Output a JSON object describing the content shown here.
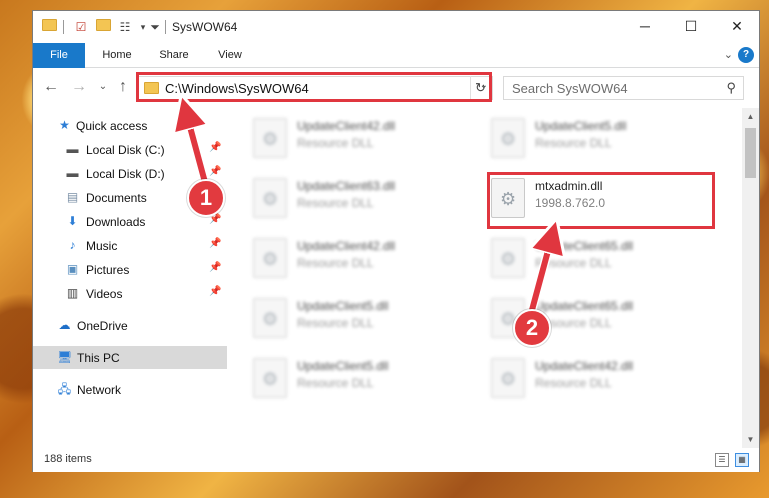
{
  "window": {
    "title": "SysWOW64",
    "controls": {
      "minimize": "─",
      "maximize": "☐",
      "close": "✕"
    }
  },
  "ribbon": {
    "tabs": [
      "File",
      "Home",
      "Share",
      "View"
    ],
    "help": "?"
  },
  "nav": {
    "address": "C:\\Windows\\SysWOW64",
    "search_placeholder": "Search SysWOW64"
  },
  "sidebar": {
    "items": [
      {
        "label": "Quick access",
        "icon": "star-icon",
        "pinned": false
      },
      {
        "label": "Local Disk (C:)",
        "icon": "drive-icon",
        "pinned": true
      },
      {
        "label": "Local Disk (D:)",
        "icon": "drive-icon",
        "pinned": true
      },
      {
        "label": "Documents",
        "icon": "documents-icon",
        "pinned": true
      },
      {
        "label": "Downloads",
        "icon": "download-icon",
        "pinned": true
      },
      {
        "label": "Music",
        "icon": "music-icon",
        "pinned": true
      },
      {
        "label": "Pictures",
        "icon": "pictures-icon",
        "pinned": true
      },
      {
        "label": "Videos",
        "icon": "videos-icon",
        "pinned": true
      },
      {
        "label": "OneDrive",
        "icon": "cloud-icon",
        "pinned": false
      },
      {
        "label": "This PC",
        "icon": "computer-icon",
        "pinned": false,
        "selected": true
      },
      {
        "label": "Network",
        "icon": "network-icon",
        "pinned": false
      }
    ]
  },
  "files": [
    {
      "name": "UpdateClient42.dll",
      "desc": "Resource DLL"
    },
    {
      "name": "UpdateClient5.dll",
      "desc": "Resource DLL"
    },
    {
      "name": "UpdateClient63.dll",
      "desc": "Resource DLL"
    },
    {
      "name": "mtxadmin.dll",
      "desc": "1998.8.762.0",
      "highlighted": true
    },
    {
      "name": "UpdateClient42.dll",
      "desc": "Resource DLL"
    },
    {
      "name": "UpdateClient65.dll",
      "desc": "Resource DLL"
    },
    {
      "name": "UpdateClient5.dll",
      "desc": "Resource DLL"
    },
    {
      "name": "UpdateClient65.dll",
      "desc": "Resource DLL"
    },
    {
      "name": "UpdateClient5.dll",
      "desc": "Resource DLL"
    },
    {
      "name": "UpdateClient42.dll",
      "desc": "Resource DLL"
    }
  ],
  "status": {
    "item_count": "188 items"
  },
  "annotations": {
    "step1": "1",
    "step2": "2",
    "color": "#e0363f"
  }
}
